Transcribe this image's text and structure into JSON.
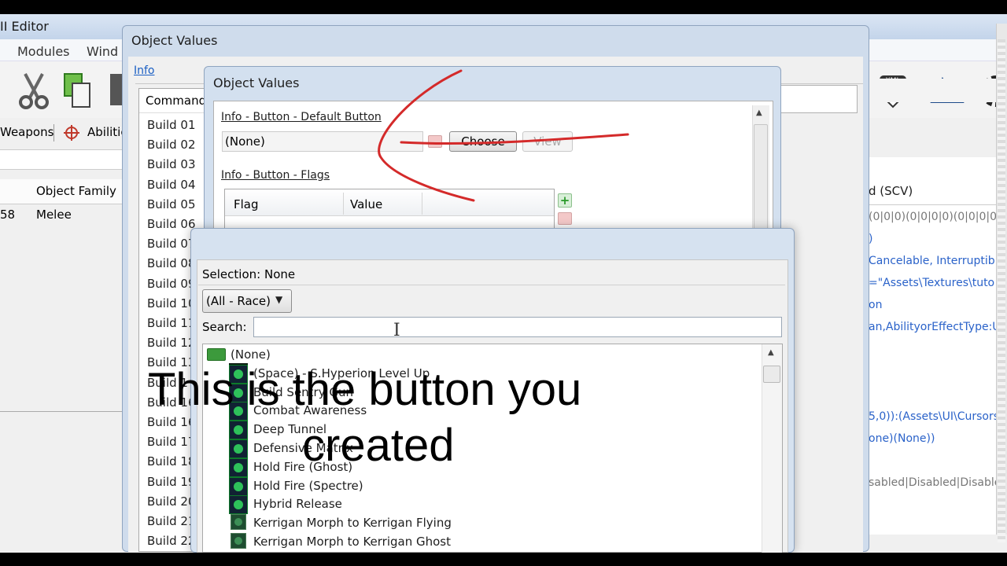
{
  "editor": {
    "title": "II Editor",
    "menu": [
      "Modules",
      "Wind"
    ],
    "tabs": [
      "Weapons",
      "Abilitie"
    ],
    "list_header": "Object Family",
    "list_row": {
      "id": "58",
      "family": "Melee"
    },
    "right_panel": {
      "header": "d (SCV)",
      "lines": [
        "(0|0|0)(0|0|0|0)(0|0|0|0)(0",
        ")",
        "Cancelable, Interruptible",
        "=\"Assets\\Textures\\tuto",
        "on",
        "an,AbilityorEffectType:U",
        "5,0)):(Assets\\UI\\Cursors",
        "one)(None))",
        "sabled|Disabled|Disable"
      ]
    }
  },
  "dialog1": {
    "title": "Object Values",
    "info_link": "Info",
    "command_header": "Command",
    "commands": [
      "Build 01",
      "Build 02",
      "Build 03",
      "Build 04",
      "Build 05",
      "Build 06",
      "Build 07",
      "Build 08",
      "Build 09",
      "Build 10",
      "Build 11",
      "Build 12",
      "Build 13",
      "Build 1",
      "Build 16",
      "Build 16",
      "Build 17",
      "Build 18",
      "Build 19",
      "Build 20",
      "Build 21",
      "Build 22"
    ]
  },
  "dialog2": {
    "title": "Object Values",
    "default_button_label": "Info - Button - Default Button",
    "default_button_value": "(None)",
    "choose_label": "Choose",
    "view_label": "View",
    "flags_label": "Info - Button - Flags",
    "flags_columns": [
      "Flag",
      "Value"
    ]
  },
  "dialog3": {
    "selection_label": "Selection:",
    "selection_value": "None",
    "race_filter": "(All - Race)",
    "search_label": "Search:",
    "search_value": "",
    "tree": [
      "(None)",
      "(Space) - S.Hyperion Level Up",
      "Build Sentry Gun",
      "Combat Awareness",
      "Deep Tunnel",
      "Defensive Matrix",
      "Hold Fire (Ghost)",
      "Hold Fire (Spectre)",
      "Hybrid Release",
      "Kerrigan Morph to Kerrigan Flying",
      "Kerrigan Morph to Kerrigan Ghost"
    ]
  },
  "caption": {
    "line1": "This is the button you",
    "line2": "created"
  },
  "colors": {
    "annotation": "#d42a2a",
    "link": "#1a5fc4",
    "title_bar": "#cfdcec"
  }
}
